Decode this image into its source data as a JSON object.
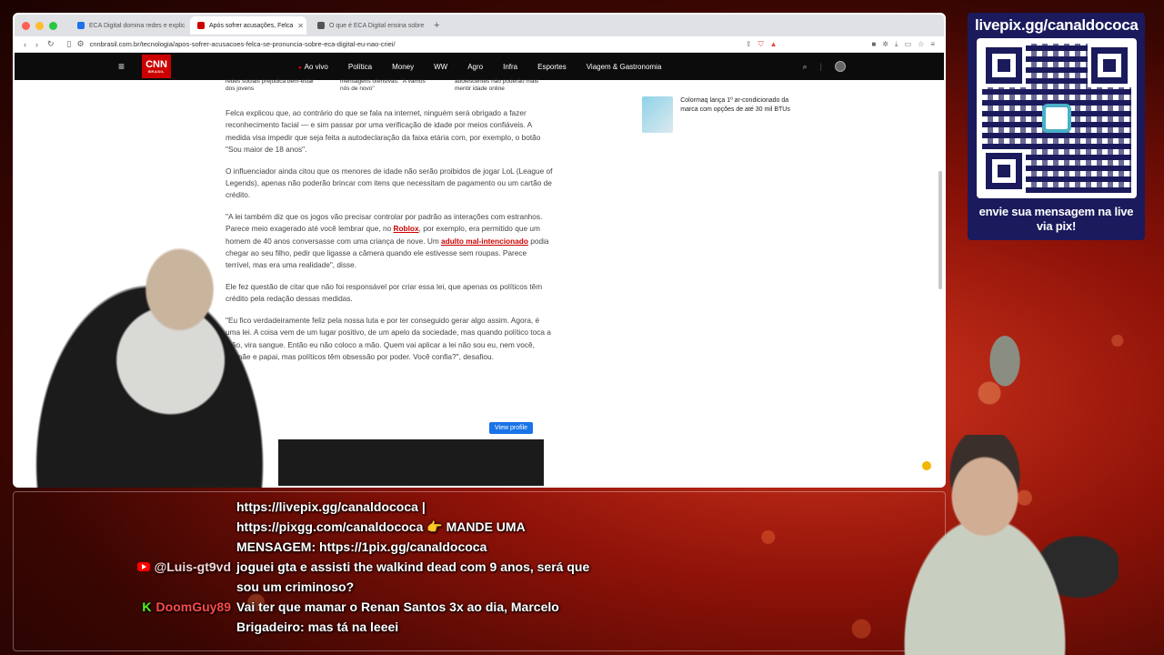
{
  "browser": {
    "tabs": [
      {
        "label": "ECA Digital domina redes e explic",
        "active": false,
        "color": "#1a73e8"
      },
      {
        "label": "Após sofrer acusações, Felca",
        "active": true,
        "color": "#cc0000"
      },
      {
        "label": "O que é ECA Digital ensina sobre",
        "active": false,
        "color": "#555555"
      }
    ],
    "url": "cnnbrasil.com.br/tecnologia/apos-sofrer-acusacoes-felca-se-pronuncia-sobre-eca-digital-eu-nao-criei/"
  },
  "cnn": {
    "logo": "CNN",
    "logo_sub": "BRASIL",
    "nav": [
      "Ao vivo",
      "Política",
      "Money",
      "WW",
      "Agro",
      "Infra",
      "Esportes",
      "Viagem & Gastronomia"
    ]
  },
  "article": {
    "related": [
      "redes sociais prejudica bem-estar dos jovens",
      "mensagens ofensivas: \"A vamos nós de novo\"",
      "adolescentes não poderão mais mentir idade online"
    ],
    "p1": "Felca explicou que, ao contrário do que se fala na internet, ninguém será obrigado a fazer reconhecimento facial — e sim passar por uma verificação de idade por meios confiáveis. A medida visa impedir que seja feita a autodeclaração da faixa etária com, por exemplo, o botão \"Sou maior de 18 anos\".",
    "p2": "O influenciador ainda citou que os menores de idade não serão proibidos de jogar LoL (League of Legends), apenas não poderão brincar com itens que necessitam de pagamento ou um cartão de crédito.",
    "p3_a": "\"A lei também diz que os jogos vão precisar controlar por padrão as interações com estranhos. Parece meio exagerado até você lembrar que, no ",
    "p3_link1": "Roblox",
    "p3_b": ", por exemplo, era permitido que um homem de 40 anos conversasse com uma criança de nove. Um ",
    "p3_link2": "adulto mal-intencionado",
    "p3_c": " podia chegar ao seu filho, pedir que ligasse a câmera quando ele estivesse sem roupas. Parece terrível, mas era uma realidade\", disse.",
    "p4": "Ele fez questão de citar que não foi responsável por criar essa lei, que apenas os políticos têm crédito pela redação dessas medidas.",
    "p5": "\"Eu fico verdadeiramente feliz pela nossa luta e por ter conseguido gerar algo assim. Agora, é uma lei. A coisa vem de um lugar positivo, de um apelo da sociedade, mas quando político toca a mão, vira sangue. Então eu não coloco a mão. Quem vai aplicar a lei não sou eu, nem você, mamãe e papai, mas políticos têm obsessão por poder. Você confia?\", desafiou.",
    "view_profile": "View profile"
  },
  "sidebar": {
    "item": "Colormaq lança 1º ar-condicionado da marca com opções de até 30 mil BTUs"
  },
  "overlay": {
    "qr_title": "livepix.gg/canaldococa",
    "qr_caption": "envie sua mensagem na live via pix!"
  },
  "chat": [
    {
      "author": "",
      "platform": "",
      "text": "https://livepix.gg/canaldococa | https://pixgg.com/canaldococa 👉 MANDE UMA MENSAGEM: https://1pix.gg/canaldococa"
    },
    {
      "author": "@Luis-gt9vd",
      "platform": "youtube",
      "text": "joguei gta e assisti the walkind dead com 9 anos, será que sou um criminoso?"
    },
    {
      "author": "DoomGuy89",
      "platform": "kick",
      "text": "Vai ter que mamar o Renan Santos 3x ao dia, Marcelo Brigadeiro: mas tá na leeei"
    }
  ]
}
